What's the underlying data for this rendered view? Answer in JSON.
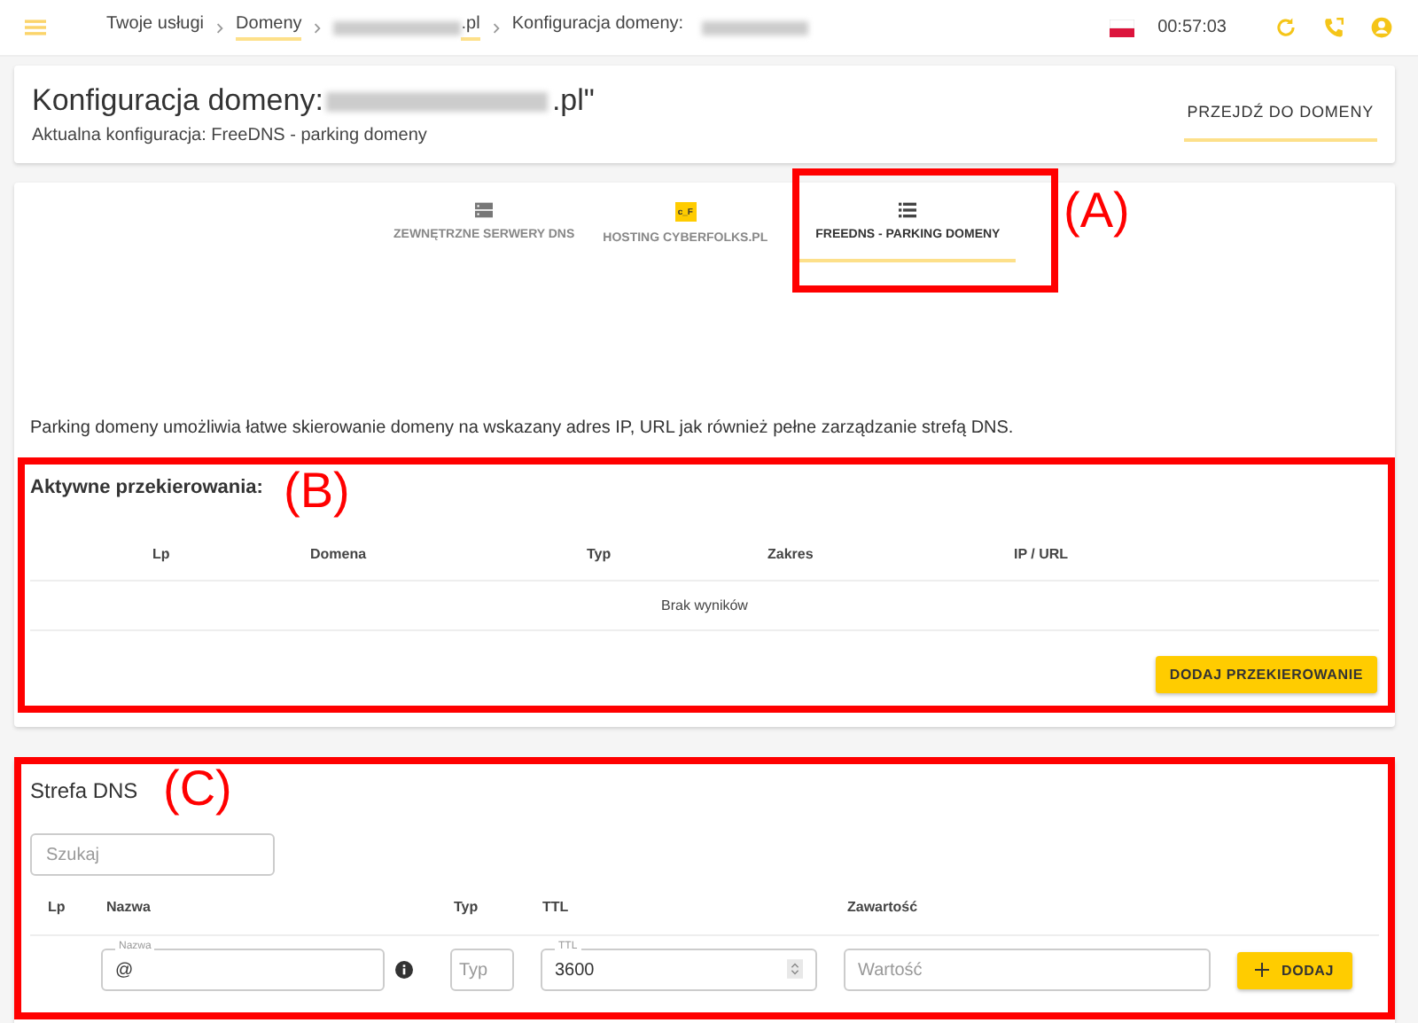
{
  "topbar": {
    "breadcrumbs": [
      {
        "label": "Twoje usługi",
        "link": false,
        "kind": "plain"
      },
      {
        "label": "Domeny",
        "link": true,
        "kind": "plain"
      },
      {
        "label": ".pl",
        "link": true,
        "kind": "blur_before"
      },
      {
        "label": "Konfiguracja domeny:",
        "link": false,
        "kind": "blur_after"
      }
    ],
    "time": "00:57:03"
  },
  "header": {
    "title_prefix": "Konfiguracja domeny:",
    "title_suffix": ".pl\"",
    "subtitle": "Aktualna konfiguracja: FreeDNS - parking domeny",
    "button": "PRZEJDŹ DO DOMENY"
  },
  "tabs": [
    {
      "label": "ZEWNĘTRZNE SERWERY DNS",
      "kind": "servers",
      "selected": false
    },
    {
      "label": "HOSTING CYBERFOLKS.PL",
      "kind": "logo",
      "logo_text": "c_F",
      "selected": false
    },
    {
      "label": "FREEDNS - PARKING DOMENY",
      "kind": "list",
      "selected": true
    }
  ],
  "description": "Parking domeny umożliwia łatwe skierowanie domeny na wskazany adres IP, URL jak również pełne zarządzanie strefą DNS.",
  "redirects": {
    "title": "Aktywne przekierowania:",
    "columns": [
      "Lp",
      "Domena",
      "Typ",
      "Zakres",
      "IP / URL"
    ],
    "empty": "Brak wyników",
    "button": "DODAJ PRZEKIEROWANIE"
  },
  "dns": {
    "title": "Strefa DNS",
    "search_placeholder": "Szukaj",
    "columns": [
      "Lp",
      "Nazwa",
      "Typ",
      "TTL",
      "Zawartość"
    ],
    "name_label": "Nazwa",
    "name_value": "@",
    "type_placeholder": "Typ",
    "ttl_label": "TTL",
    "ttl_value": "3600",
    "value_placeholder": "Wartość",
    "button": "DODAJ"
  },
  "annotations": [
    "(A)",
    "(B)",
    "(C)"
  ]
}
